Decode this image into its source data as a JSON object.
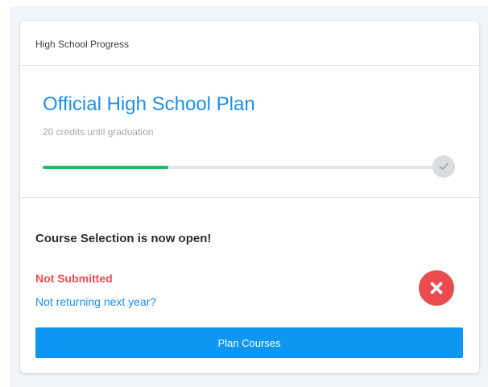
{
  "card": {
    "header_title": "High School Progress"
  },
  "plan": {
    "title": "Official High School Plan",
    "subtitle": "20 credits until graduation",
    "progress_percent": 32
  },
  "course_selection": {
    "heading": "Course Selection is now open!",
    "status": "Not Submitted",
    "not_returning_link": "Not returning next year?",
    "plan_button_label": "Plan Courses"
  },
  "icons": {
    "goal": "check-icon",
    "status": "close-circle-icon"
  },
  "colors": {
    "accent_blue": "#1f8ee6",
    "button_blue": "#0d96f2",
    "progress_green": "#1dbb5e",
    "error_red": "#ea4b4f",
    "track_gray": "#e2e5e9"
  }
}
